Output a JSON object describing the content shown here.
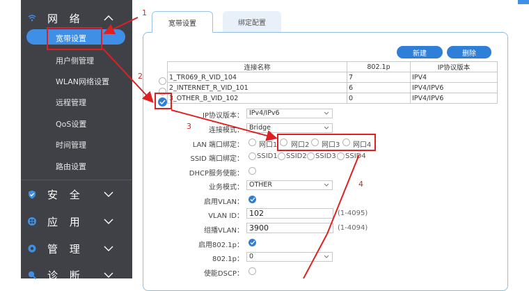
{
  "sidebar": {
    "network": {
      "label": "网 络",
      "icon": "wifi-icon"
    },
    "sub_items": [
      "宽带设置",
      "用户侧管理",
      "WLAN网络设置",
      "远程管理",
      "QoS设置",
      "时间管理",
      "路由设置"
    ],
    "security": {
      "label": "安 全",
      "icon": "shield-icon"
    },
    "apply": {
      "label": "应 用",
      "icon": "apps-icon"
    },
    "manage": {
      "label": "管 理",
      "icon": "gear-icon"
    },
    "diagnose": {
      "label": "诊 断",
      "icon": "diagnose-icon"
    }
  },
  "tabs": [
    {
      "label": "宽带设置"
    },
    {
      "label": "绑定配置"
    }
  ],
  "buttons": {
    "new": "新建",
    "delete": "删除"
  },
  "table": {
    "headers": [
      "连接名称",
      "802.1p",
      "IP协议版本"
    ],
    "rows": [
      {
        "name": "1_TR069_R_VID_104",
        "p": "7",
        "ip": "IPV4",
        "selected": false
      },
      {
        "name": "2_INTERNET_R_VID_101",
        "p": "6",
        "ip": "IPV4/IPV6",
        "selected": false
      },
      {
        "name": "3_OTHER_B_VID_102",
        "p": "0",
        "ip": "IPV4/IPV6",
        "selected": true
      }
    ]
  },
  "form": {
    "ip_version": {
      "label": "IP协议版本：",
      "value": "IPv4/IPv6"
    },
    "conn_mode": {
      "label": "连接模式：",
      "value": "Bridge"
    },
    "lan_bind": {
      "label": "LAN 端口绑定：",
      "options": [
        "网口1",
        "网口2",
        "网口3",
        "网口4"
      ]
    },
    "ssid_bind": {
      "label": "SSID 端口绑定：",
      "options": [
        "SSID1",
        "SSID2",
        "SSID3",
        "SSID4"
      ]
    },
    "dhcp": {
      "label": "DHCP服务使能："
    },
    "service_mode": {
      "label": "业务模式：",
      "value": "OTHER"
    },
    "enable_vlan": {
      "label": "启用VLAN："
    },
    "vlan_id": {
      "label": "VLAN ID：",
      "value": "102",
      "hint": "(1-4095)"
    },
    "multicast_vlan": {
      "label": "组播VLAN：",
      "value": "3900",
      "hint": "(1-4094)"
    },
    "enable_8021p": {
      "label": "启用802.1p："
    },
    "p8021": {
      "label": "802.1p：",
      "value": "0"
    },
    "dscp": {
      "label": "使能DSCP："
    }
  },
  "annotations": [
    "1",
    "2",
    "3",
    "4"
  ],
  "colors": {
    "accent": "#2f7fd9",
    "sidebar": "#3f4147",
    "annotation": "#e02020"
  }
}
